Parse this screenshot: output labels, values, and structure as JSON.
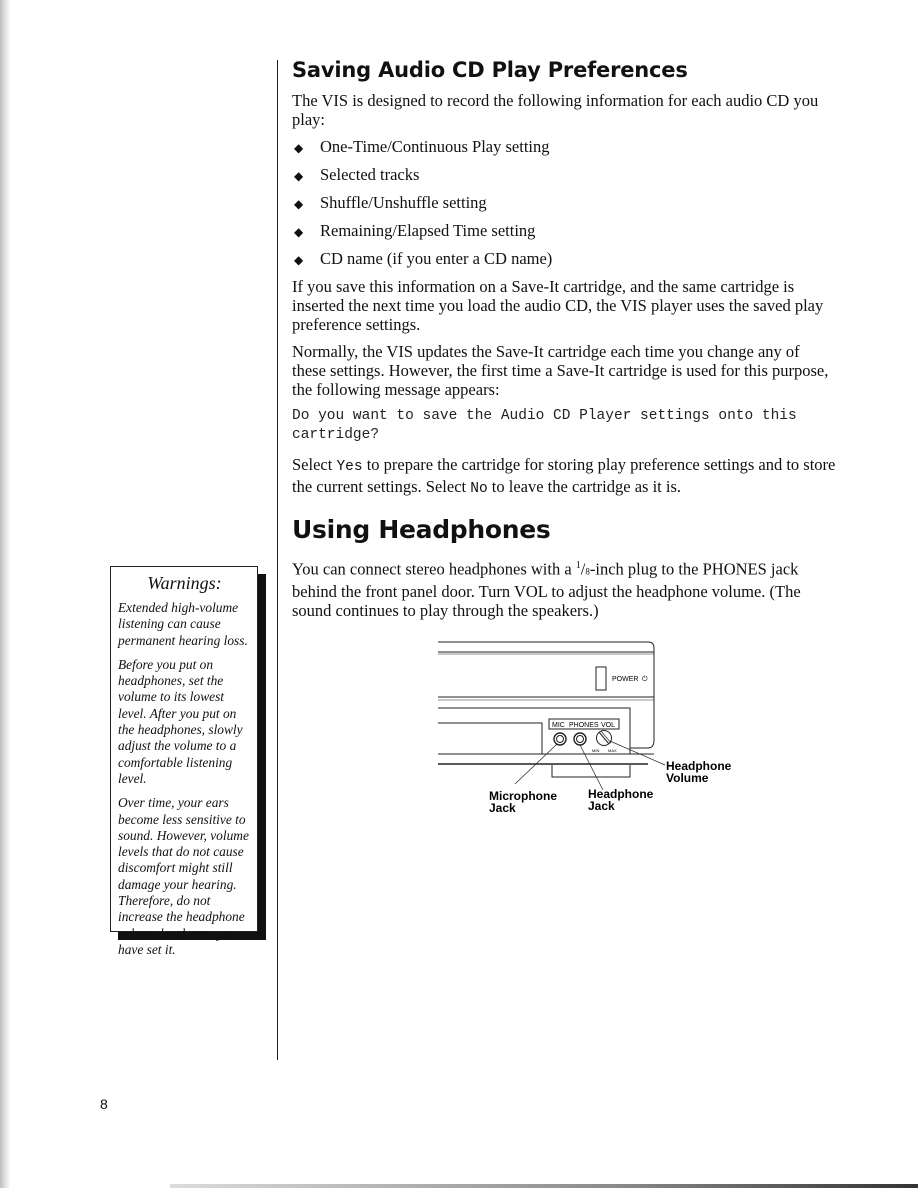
{
  "page_number": "8",
  "section_saving": {
    "title": "Saving Audio CD Play Preferences",
    "intro": "The VIS is designed to record the following information for each audio CD you play:",
    "bullet_glyph": "◆",
    "bullets": [
      "One-Time/Continuous Play setting",
      "Selected tracks",
      "Shuffle/Unshuffle setting",
      "Remaining/Elapsed Time setting",
      "CD name (if you enter a CD name)"
    ],
    "para_save": "If you save this information on a Save-It cartridge, and the same cartridge is inserted the next time you load the audio CD, the VIS player uses the saved play preference settings.",
    "para_normally": "Normally, the VIS updates the Save-It cartridge each time you change any of these settings. However, the first time a Save-It cartridge is used for this purpose, the following message appears:",
    "message": "Do you want to save the Audio CD Player settings onto this cartridge?",
    "select_parts": {
      "t1": "Select ",
      "yes": "Yes",
      "t2": " to prepare the cartridge for storing play preference settings and to store the current settings. Select ",
      "no": "No",
      "t3": " to leave the cartridge as it is."
    }
  },
  "section_headphones": {
    "title": "Using Headphones",
    "para_parts": {
      "t1": "You can connect stereo headphones with a ",
      "frac_num": "1",
      "frac_slash": "/",
      "frac_den": "8",
      "t2": "-inch plug to the PHONES jack behind the front panel door. Turn VOL to adjust the headphone volume. (The sound continues to play through the speakers.)"
    }
  },
  "figure": {
    "panel_labels": {
      "power": "POWER",
      "mic": "MIC",
      "phones": "PHONES",
      "vol": "VOL",
      "min": "MIN",
      "max": "MAX"
    },
    "callouts": {
      "microphone_jack_line1": "Microphone",
      "microphone_jack_line2": "Jack",
      "headphone_jack_line1": "Headphone",
      "headphone_jack_line2": "Jack",
      "headphone_volume_line1": "Headphone",
      "headphone_volume_line2": "Volume"
    }
  },
  "warnings": {
    "title": "Warnings:",
    "paragraphs": [
      "Extended high-volume listening can cause permanent hearing loss.",
      "Before you put on headphones, set the volume to its lowest level. After you put on the headphones, slowly adjust the volume to a comfortable listening level.",
      "Over time, your ears become less sensitive to sound. However, volume levels that do not cause discomfort might still damage your hearing. Therefore, do not increase the headphone volume level once you have set it."
    ]
  }
}
